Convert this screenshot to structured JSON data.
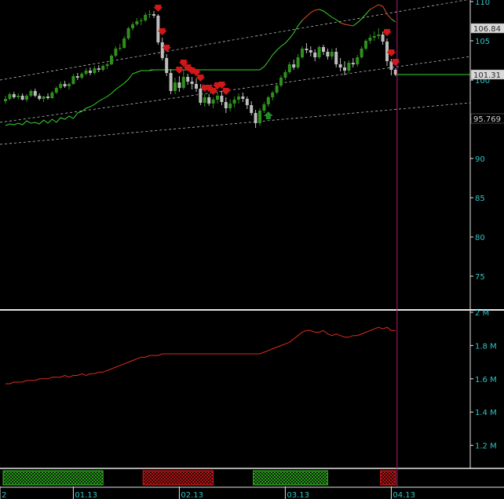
{
  "chart_data": [
    {
      "type": "candlestick",
      "panel": "price",
      "ylim": [
        71,
        110
      ],
      "y_ticks": [
        75,
        80,
        85,
        90,
        95,
        100,
        105,
        110
      ],
      "y_tick_labels": [
        "75",
        "80",
        "85",
        "90",
        "95",
        "100",
        "105",
        "110"
      ],
      "price_flags": [
        {
          "label": "106.84",
          "value": 106.6,
          "color": "#d8d8d8"
        },
        {
          "label": "101.31",
          "value": 100.7,
          "color": "#d8d8d8"
        },
        {
          "label": "95.769",
          "value": 95.1,
          "color": "#000000"
        }
      ],
      "colors": {
        "up": "#2f8f1d",
        "down": "#bdbdbd",
        "ma": "#37d62a",
        "ma_above": "#e02a20",
        "level": "#c040c0",
        "arrow_down": "#d01818",
        "arrow_up": "#1d8f2a",
        "cursor": "#b0207a",
        "channel": "#bbbbbb"
      },
      "candles": [
        [
          97.3,
          98.0,
          97.0,
          97.6
        ],
        [
          97.6,
          98.4,
          97.4,
          98.2
        ],
        [
          98.2,
          98.5,
          97.6,
          97.8
        ],
        [
          97.8,
          98.3,
          97.5,
          98.0
        ],
        [
          98.0,
          98.3,
          97.4,
          97.5
        ],
        [
          97.5,
          98.2,
          97.2,
          98.0
        ],
        [
          98.0,
          98.8,
          97.8,
          98.6
        ],
        [
          98.6,
          98.9,
          97.8,
          98.0
        ],
        [
          98.0,
          98.3,
          97.4,
          97.6
        ],
        [
          97.6,
          98.0,
          97.2,
          97.9
        ],
        [
          97.9,
          98.3,
          97.5,
          97.7
        ],
        [
          97.7,
          98.6,
          97.6,
          98.4
        ],
        [
          98.4,
          99.2,
          98.2,
          99.0
        ],
        [
          99.0,
          99.8,
          98.8,
          99.5
        ],
        [
          99.5,
          99.9,
          99.0,
          99.2
        ],
        [
          99.2,
          99.7,
          98.8,
          99.5
        ],
        [
          99.5,
          100.8,
          99.4,
          100.5
        ],
        [
          100.5,
          100.9,
          100.0,
          100.3
        ],
        [
          100.3,
          101.0,
          100.1,
          100.8
        ],
        [
          100.8,
          101.5,
          100.6,
          101.2
        ],
        [
          101.2,
          101.6,
          100.6,
          100.9
        ],
        [
          100.9,
          101.8,
          100.7,
          101.5
        ],
        [
          101.5,
          101.9,
          101.0,
          101.3
        ],
        [
          101.3,
          102.0,
          101.1,
          101.8
        ],
        [
          101.8,
          102.2,
          101.4,
          102.0
        ],
        [
          102.0,
          103.3,
          101.9,
          103.1
        ],
        [
          103.1,
          104.3,
          102.9,
          104.0
        ],
        [
          104.0,
          104.6,
          103.7,
          104.1
        ],
        [
          104.1,
          105.6,
          104.0,
          105.3
        ],
        [
          105.3,
          106.8,
          105.1,
          106.6
        ],
        [
          106.6,
          107.4,
          106.3,
          107.1
        ],
        [
          107.1,
          107.9,
          106.9,
          107.5
        ],
        [
          107.5,
          107.9,
          107.0,
          107.6
        ],
        [
          107.6,
          108.6,
          107.4,
          108.3
        ],
        [
          108.3,
          108.9,
          107.9,
          108.4
        ],
        [
          108.4,
          108.8,
          107.9,
          108.2
        ],
        [
          108.2,
          108.4,
          104.5,
          104.8
        ],
        [
          104.8,
          105.4,
          102.5,
          102.8
        ],
        [
          102.8,
          103.3,
          100.5,
          100.9
        ],
        [
          100.9,
          101.4,
          98.2,
          98.6
        ],
        [
          98.6,
          100.3,
          98.2,
          99.7
        ],
        [
          99.7,
          100.5,
          98.5,
          99.0
        ],
        [
          99.0,
          101.4,
          98.8,
          100.4
        ],
        [
          100.4,
          100.8,
          99.4,
          99.8
        ],
        [
          99.8,
          100.4,
          98.8,
          99.5
        ],
        [
          99.5,
          100.2,
          98.5,
          98.9
        ],
        [
          98.9,
          99.5,
          96.8,
          97.1
        ],
        [
          97.1,
          98.2,
          96.6,
          97.8
        ],
        [
          97.8,
          98.2,
          96.7,
          97.0
        ],
        [
          97.0,
          97.8,
          96.4,
          97.5
        ],
        [
          97.5,
          98.5,
          97.0,
          98.0
        ],
        [
          98.0,
          98.6,
          96.8,
          97.2
        ],
        [
          97.2,
          97.8,
          95.8,
          96.4
        ],
        [
          96.4,
          97.5,
          96.0,
          97.0
        ],
        [
          97.0,
          97.9,
          96.5,
          97.5
        ],
        [
          97.5,
          98.3,
          97.0,
          97.9
        ],
        [
          97.9,
          98.4,
          97.2,
          97.6
        ],
        [
          97.6,
          97.9,
          96.3,
          96.8
        ],
        [
          96.8,
          97.3,
          95.5,
          95.8
        ],
        [
          95.8,
          96.2,
          93.9,
          94.5
        ],
        [
          94.5,
          96.4,
          94.2,
          96.1
        ],
        [
          96.1,
          97.2,
          95.8,
          96.9
        ],
        [
          96.9,
          98.0,
          96.6,
          97.8
        ],
        [
          97.8,
          98.6,
          97.4,
          98.4
        ],
        [
          98.4,
          99.6,
          98.2,
          99.3
        ],
        [
          99.3,
          100.6,
          99.1,
          100.3
        ],
        [
          100.3,
          101.3,
          100.0,
          101.0
        ],
        [
          101.0,
          102.3,
          100.8,
          102.0
        ],
        [
          102.0,
          102.6,
          101.3,
          101.6
        ],
        [
          101.6,
          103.3,
          101.4,
          102.9
        ],
        [
          102.9,
          104.3,
          102.7,
          104.0
        ],
        [
          104.0,
          104.7,
          103.4,
          103.8
        ],
        [
          103.8,
          104.3,
          103.0,
          103.5
        ],
        [
          103.5,
          103.9,
          102.4,
          102.9
        ],
        [
          102.9,
          104.4,
          102.7,
          104.2
        ],
        [
          104.2,
          104.5,
          103.2,
          103.6
        ],
        [
          103.6,
          104.0,
          102.6,
          103.0
        ],
        [
          103.0,
          104.0,
          102.6,
          103.6
        ],
        [
          103.6,
          104.1,
          101.6,
          102.0
        ],
        [
          102.0,
          102.8,
          101.1,
          101.6
        ],
        [
          101.6,
          102.4,
          100.6,
          101.2
        ],
        [
          101.2,
          102.5,
          100.9,
          102.2
        ],
        [
          102.2,
          102.8,
          101.6,
          102.0
        ],
        [
          102.0,
          103.2,
          101.7,
          102.9
        ],
        [
          102.9,
          104.3,
          102.7,
          104.0
        ],
        [
          104.0,
          105.2,
          103.8,
          105.0
        ],
        [
          105.0,
          105.8,
          104.6,
          105.4
        ],
        [
          105.4,
          106.2,
          105.0,
          105.6
        ],
        [
          105.6,
          106.6,
          105.2,
          105.8
        ],
        [
          105.8,
          106.2,
          104.5,
          104.9
        ],
        [
          104.9,
          105.3,
          101.8,
          102.4
        ],
        [
          102.4,
          102.7,
          100.6,
          101.3
        ],
        [
          101.3,
          101.5,
          100.5,
          100.7
        ]
      ],
      "ma_line": [
        94.2,
        94.4,
        94.3,
        94.5,
        94.3,
        94.8,
        94.5,
        94.6,
        94.4,
        94.9,
        94.5,
        95.0,
        94.6,
        95.2,
        95.0,
        95.4,
        95.1,
        95.8,
        96.0,
        96.4,
        96.6,
        96.9,
        97.3,
        97.6,
        97.9,
        98.3,
        98.8,
        99.2,
        99.6,
        100.1,
        100.8,
        101.0,
        101.2,
        101.2,
        101.2,
        101.3,
        101.3,
        101.3,
        101.3,
        101.3,
        101.3,
        101.3,
        101.3,
        101.3,
        101.3,
        101.3,
        101.3,
        101.3,
        101.3,
        101.3,
        101.3,
        101.3,
        101.3,
        101.3,
        101.3,
        101.3,
        101.3,
        101.3,
        101.3,
        101.3,
        101.3,
        101.7,
        102.4,
        103.2,
        103.8,
        104.3,
        104.7,
        105.3,
        106.0,
        106.9,
        107.6,
        108.1,
        108.6,
        108.9,
        109.0,
        108.8,
        108.4,
        108.0,
        107.7,
        107.3,
        107.1,
        107.0,
        106.9,
        107.3,
        107.8,
        108.4,
        109.0,
        109.3,
        109.6,
        109.4,
        108.4,
        107.8,
        107.4
      ],
      "ma_above_price_from": 78,
      "volume_labels_note": ""
    },
    {
      "type": "line",
      "panel": "indicator",
      "ylim": [
        1.08,
        2.0
      ],
      "y_ticks": [
        1.2,
        1.4,
        1.6,
        1.8,
        2.0
      ],
      "y_tick_labels": [
        "1.2 M",
        "1.4 M",
        "1.6 M",
        "1.8 M",
        "2 M"
      ],
      "series": [
        {
          "color": "#e02a20",
          "values": [
            1.57,
            1.57,
            1.58,
            1.58,
            1.58,
            1.59,
            1.59,
            1.59,
            1.6,
            1.6,
            1.6,
            1.61,
            1.61,
            1.61,
            1.62,
            1.61,
            1.62,
            1.62,
            1.63,
            1.62,
            1.63,
            1.63,
            1.64,
            1.64,
            1.65,
            1.66,
            1.67,
            1.68,
            1.69,
            1.7,
            1.71,
            1.72,
            1.73,
            1.73,
            1.74,
            1.74,
            1.74,
            1.75,
            1.75,
            1.75,
            1.75,
            1.75,
            1.75,
            1.75,
            1.75,
            1.75,
            1.75,
            1.75,
            1.75,
            1.75,
            1.75,
            1.75,
            1.75,
            1.75,
            1.75,
            1.75,
            1.75,
            1.75,
            1.75,
            1.75,
            1.75,
            1.76,
            1.77,
            1.78,
            1.79,
            1.8,
            1.81,
            1.82,
            1.84,
            1.86,
            1.88,
            1.89,
            1.89,
            1.88,
            1.88,
            1.89,
            1.87,
            1.86,
            1.87,
            1.86,
            1.85,
            1.85,
            1.86,
            1.86,
            1.87,
            1.88,
            1.89,
            1.9,
            1.91,
            1.9,
            1.91,
            1.89,
            1.89
          ]
        }
      ]
    }
  ],
  "x_axis": {
    "tick_labels": [
      "2",
      "01.13",
      "02.13",
      "03.13",
      "04.13"
    ],
    "tick_index": [
      -7,
      16,
      41,
      66,
      91
    ]
  },
  "status_bands": [
    {
      "from": 0,
      "to": 23,
      "color": "#2fb31f"
    },
    {
      "from": 33,
      "to": 49,
      "color": "#d01818"
    },
    {
      "from": 59,
      "to": 76,
      "color": "#2fb31f"
    },
    {
      "from": 89,
      "to": 92,
      "color": "#d01818"
    }
  ],
  "markers": {
    "down_arrows": [
      36,
      37,
      38,
      41,
      42,
      43,
      44,
      45,
      46,
      47,
      48,
      49,
      50,
      51,
      52,
      90,
      91,
      92
    ],
    "up_arrows": [
      62
    ]
  },
  "cursor_index": 92
}
